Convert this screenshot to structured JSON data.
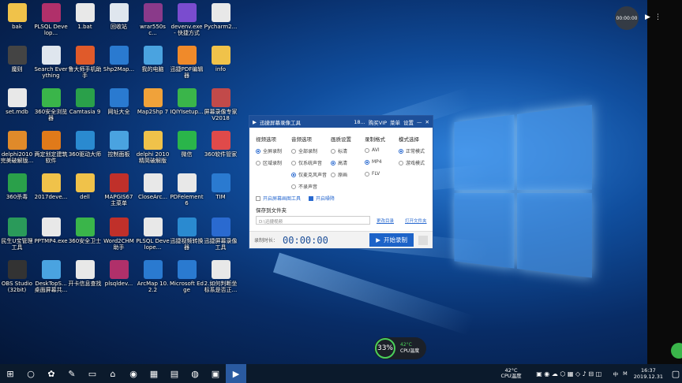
{
  "desktop_icons": [
    {
      "label": "bak",
      "color": "#f0c24a"
    },
    {
      "label": "PLSQL Develop...",
      "color": "#b0306a"
    },
    {
      "label": "1.bat",
      "color": "#e8e8e8"
    },
    {
      "label": "回收站",
      "color": "#dfe6ee"
    },
    {
      "label": "wrar550sc...",
      "color": "#8a3a8a"
    },
    {
      "label": "devenv.exe - 快捷方式",
      "color": "#7a4ccf"
    },
    {
      "label": "Pycharm2...",
      "color": "#e8e8e8"
    },
    {
      "label": "魔则",
      "color": "#444444"
    },
    {
      "label": "Search Everything",
      "color": "#dfe6ee"
    },
    {
      "label": "鲁大师手机助手",
      "color": "#e05a2a"
    },
    {
      "label": "Shp2Map...",
      "color": "#2a7ad0"
    },
    {
      "label": "我的电脑",
      "color": "#4aa3e0"
    },
    {
      "label": "迅捷PDF编辑器",
      "color": "#f08a2a"
    },
    {
      "label": "info",
      "color": "#f0c24a"
    },
    {
      "label": "set.mdb",
      "color": "#e8e8e8"
    },
    {
      "label": "360安全浏览器",
      "color": "#3ab54a"
    },
    {
      "label": "Camtasia 9",
      "color": "#2aa04a"
    },
    {
      "label": "网址大全",
      "color": "#2a7ad0"
    },
    {
      "label": "Map2Shp 7",
      "color": "#f0a23a"
    },
    {
      "label": "IQIYIsetup...",
      "color": "#3ab54a"
    },
    {
      "label": "屏幕录像专家V2018",
      "color": "#c24a4a"
    },
    {
      "label": "delphi2010完美破解版...",
      "color": "#e08a2a"
    },
    {
      "label": "两定划定建筑软件",
      "color": "#e07a1a"
    },
    {
      "label": "360驱动大师",
      "color": "#2a8ad0"
    },
    {
      "label": "控制面板",
      "color": "#4aa3e0"
    },
    {
      "label": "delphi 2010 精简破解版",
      "color": "#f0c24a"
    },
    {
      "label": "微信",
      "color": "#2ab54a"
    },
    {
      "label": "360软件管家",
      "color": "#e04a4a"
    },
    {
      "label": "360杀毒",
      "color": "#2aa04a"
    },
    {
      "label": "2017deve...",
      "color": "#f0c24a"
    },
    {
      "label": "dell",
      "color": "#f0c24a"
    },
    {
      "label": "MAPGIS67 主菜单",
      "color": "#c0302a"
    },
    {
      "label": "CloseArc...",
      "color": "#e8e8e8"
    },
    {
      "label": "PDFelement 6",
      "color": "#e8e8e8"
    },
    {
      "label": "TIM",
      "color": "#2a7ad0"
    },
    {
      "label": "民生U宝管理工具",
      "color": "#2a9a5a"
    },
    {
      "label": "PPTMP4.exe",
      "color": "#e8e8e8"
    },
    {
      "label": "360安全卫士",
      "color": "#3ab54a"
    },
    {
      "label": "Word2CHM 助手",
      "color": "#c0302a"
    },
    {
      "label": "PLSQL Develope...",
      "color": "#e8e8e8"
    },
    {
      "label": "迅捷视频转换器",
      "color": "#2a8ad0"
    },
    {
      "label": "迅捷屏幕录像工具",
      "color": "#2a6ad0"
    },
    {
      "label": "OBS Studio (32bit)",
      "color": "#333333"
    },
    {
      "label": "DeskTopS... 桌面屏幕共...",
      "color": "#4aa3e0"
    },
    {
      "label": "开卡信息查找",
      "color": "#e8e8e8"
    },
    {
      "label": "plsqldev...",
      "color": "#b0306a"
    },
    {
      "label": "ArcMap 10.2.2",
      "color": "#2a7ad0"
    },
    {
      "label": "Microsoft Edge",
      "color": "#2a7ad0"
    },
    {
      "label": "2.如何判断坐标系是否正...",
      "color": "#e8e8e8"
    }
  ],
  "recorder": {
    "title": "迅捷屏幕录像工具",
    "user": "18...",
    "buy_vip": "购买VIP",
    "menu": "菜单",
    "settings": "设置",
    "groups": {
      "video": {
        "title": "视频选项",
        "options": [
          {
            "label": "全屏录制",
            "on": true
          },
          {
            "label": "区域录制",
            "on": false
          }
        ]
      },
      "audio": {
        "title": "音频选项",
        "options": [
          {
            "label": "全部录制",
            "on": false
          },
          {
            "label": "仅系统声音",
            "on": false
          },
          {
            "label": "仅麦克风声音",
            "on": true
          },
          {
            "label": "不录声音",
            "on": false
          }
        ]
      },
      "quality": {
        "title": "画质设置",
        "options": [
          {
            "label": "标清",
            "on": false
          },
          {
            "label": "高清",
            "on": true
          },
          {
            "label": "原画",
            "on": false
          }
        ]
      },
      "format": {
        "title": "录制格式",
        "options": [
          {
            "label": "AVI",
            "on": false
          },
          {
            "label": "MP4",
            "on": true
          },
          {
            "label": "FLV",
            "on": false
          }
        ]
      },
      "mode": {
        "title": "模式选择",
        "options": [
          {
            "label": "正常模式",
            "on": true
          },
          {
            "label": "游戏模式",
            "on": false
          }
        ]
      }
    },
    "checkbox_draw_tool": "开启屏幕画图工具",
    "checkbox_denoise": "开启噪降",
    "save_folder_label": "保存到文件夹",
    "save_path": "D:\\迅捷视频",
    "change_dir": "更改目录",
    "open_folder": "打开文件夹",
    "duration_label": "录制时长：",
    "duration": "00:00:00",
    "start_label": "开始录制"
  },
  "player": {
    "time": "00:00:00"
  },
  "perf": {
    "percent": "33%",
    "temp": "42°C",
    "temp_label": "CPU温度"
  },
  "taskbar": {
    "weather_temp": "42°C",
    "weather_label": "CPU温度",
    "ime": "中",
    "time": "16:37",
    "date": "2019.12.31"
  },
  "colors": {
    "accent": "#1d63c8",
    "title_bar": "#1d4f99",
    "taskbar": "#0b1a2c"
  }
}
